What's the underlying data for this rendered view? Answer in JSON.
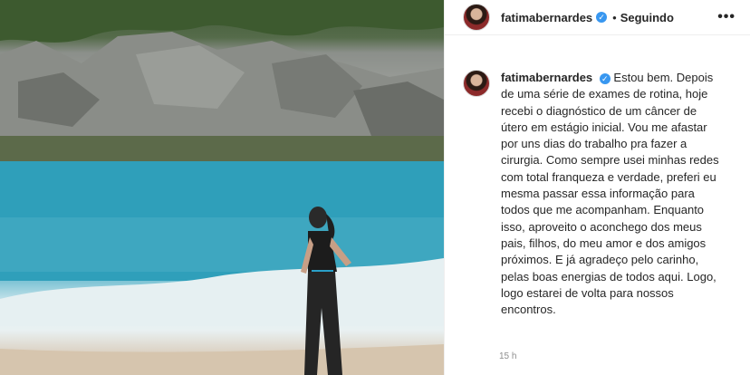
{
  "post": {
    "username": "fatimabernardes",
    "verified_icon": "verified-badge-icon",
    "separator": "•",
    "follow_status": "Seguindo",
    "more_icon": "•••",
    "caption": "Estou bem. Depois de uma série de exames de rotina, hoje recebi o diagnóstico de um câncer de útero em estágio inicial. Vou me afastar por uns dias do trabalho pra fazer a cirurgia. Como sempre usei minhas redes com total franqueza e verdade, preferi eu mesma passar essa informação para todos que me acompanham. Enquanto isso, aproveito o aconchego dos meus pais, filhos, do meu amor e dos amigos próximos. E já agradeço pelo carinho, pelas boas energias de todos aqui. Logo, logo estarei de volta para nossos encontros.",
    "timestamp": "15 h"
  },
  "colors": {
    "verified": "#3897f0",
    "muted": "#8e8e8e",
    "text": "#262626"
  }
}
